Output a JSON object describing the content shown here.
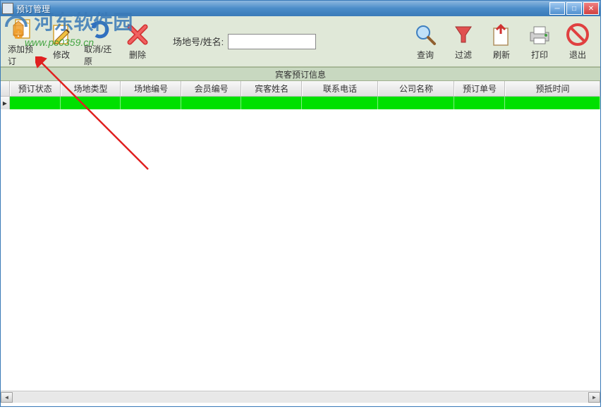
{
  "window": {
    "title": "预订管理"
  },
  "toolbar": {
    "add": "添加预订",
    "edit": "修改",
    "cancel": "取消/还原",
    "delete": "删除",
    "search_label": "场地号/姓名:",
    "search_value": "",
    "query": "查询",
    "filter": "过滤",
    "refresh": "刷新",
    "print": "打印",
    "exit": "退出"
  },
  "section": {
    "title": "宾客预订信息"
  },
  "columns": {
    "status": "预订状态",
    "venue_type": "场地类型",
    "venue_no": "场地编号",
    "member_no": "会员编号",
    "guest_name": "宾客姓名",
    "phone": "联系电话",
    "company": "公司名称",
    "order_no": "预订单号",
    "arrival_time": "预抵时间"
  },
  "watermark": {
    "text": "河东软件园",
    "url": "www.pc0359.cn"
  }
}
